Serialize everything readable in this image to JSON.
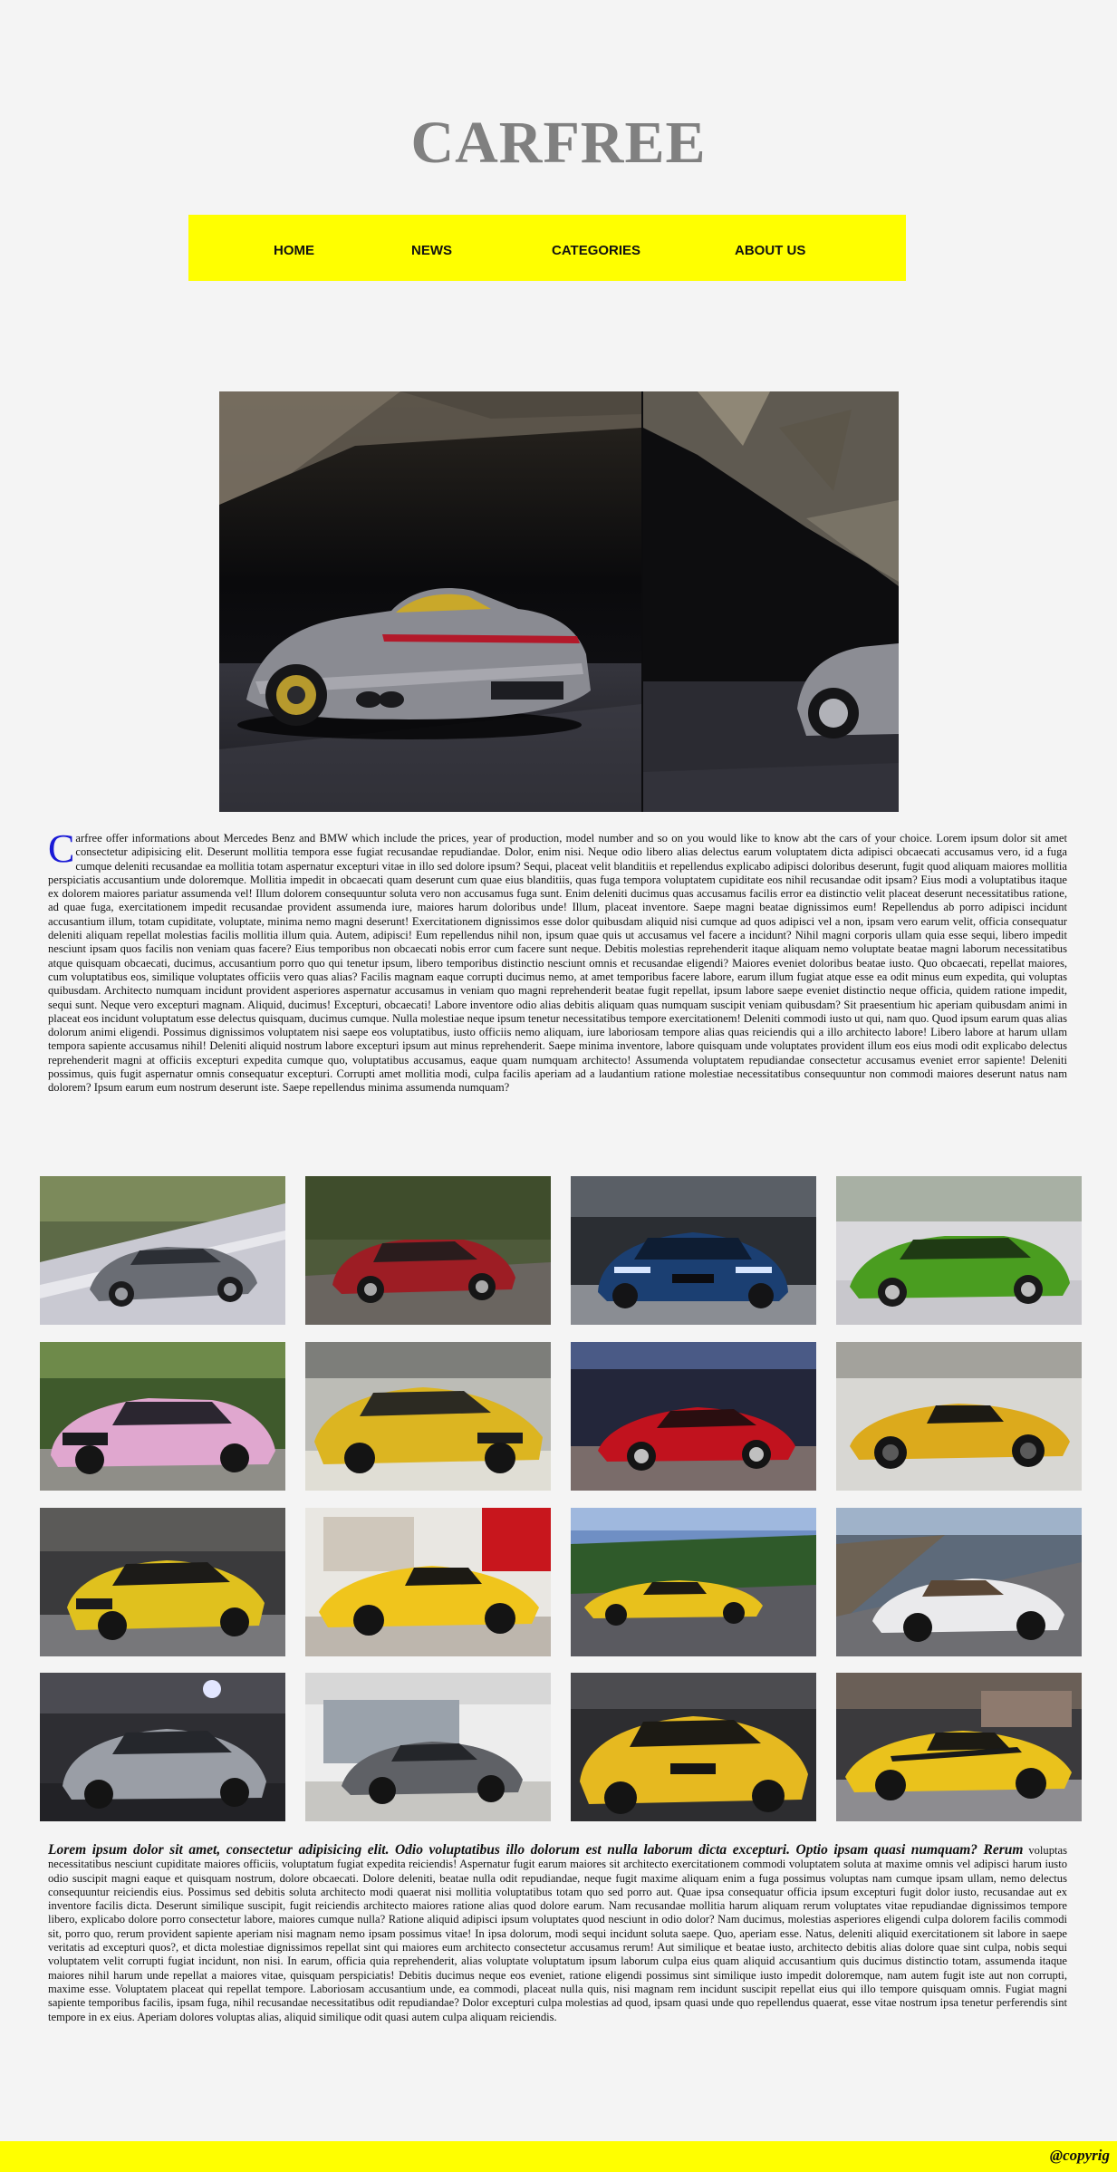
{
  "site": {
    "title": "CARFREE"
  },
  "nav": [
    {
      "label": "HOME"
    },
    {
      "label": "NEWS"
    },
    {
      "label": "CATEGORIES"
    },
    {
      "label": "ABOUT US"
    }
  ],
  "intro": {
    "dropcap": "C",
    "text": "arfree offer informations about Mercedes Benz and BMW which include the prices, year of production, model number and so on you would like to know abt the cars of your choice. Lorem ipsum dolor sit amet consectetur adipisicing elit. Deserunt mollitia tempora esse fugiat recusandae repudiandae. Dolor, enim nisi. Neque odio libero alias delectus earum voluptatem dicta adipisci obcaecati accusamus vero, id a fuga cumque deleniti recusandae ea mollitia totam aspernatur excepturi vitae in illo sed dolore ipsum? Sequi, placeat velit blanditiis et repellendus explicabo adipisci doloribus deserunt, fugit quod aliquam maiores mollitia perspiciatis accusantium unde doloremque. Mollitia impedit in obcaecati quam deserunt cum quae eius blanditiis, quas fuga tempora voluptatem cupiditate eos nihil recusandae odit ipsam? Eius modi a voluptatibus itaque ex dolorem maiores pariatur assumenda vel! Illum dolorem consequuntur soluta vero non accusamus fuga sunt. Enim deleniti ducimus quas accusamus facilis error ea distinctio velit placeat deserunt necessitatibus ratione, ad quae fuga, exercitationem impedit recusandae provident assumenda iure, maiores harum doloribus unde! Illum, placeat inventore. Saepe magni beatae dignissimos eum! Repellendus ab porro adipisci incidunt accusantium illum, totam cupiditate, voluptate, minima nemo magni deserunt! Exercitationem dignissimos esse dolor quibusdam aliquid nisi cumque ad quos adipisci vel a non, ipsam vero earum velit, officia consequatur deleniti aliquam repellat molestias facilis mollitia illum quia. Autem, adipisci! Eum repellendus nihil non, ipsum quae quis ut accusamus vel facere a incidunt? Nihil magni corporis ullam quia esse sequi, libero impedit nesciunt ipsam quos facilis non veniam quas facere? Eius temporibus non obcaecati nobis error cum facere sunt neque. Debitis molestias reprehenderit itaque aliquam nemo voluptate beatae magni laborum necessitatibus atque quisquam obcaecati, ducimus, accusantium porro quo qui tenetur ipsum, libero temporibus distinctio nesciunt omnis et recusandae eligendi? Maiores eveniet doloribus beatae iusto. Quo obcaecati, repellat maiores, cum voluptatibus eos, similique voluptates officiis vero quas alias? Facilis magnam eaque corrupti ducimus nemo, at amet temporibus facere labore, earum illum fugiat atque esse ea odit minus eum expedita, qui voluptas quibusdam. Architecto numquam incidunt provident asperiores aspernatur accusamus in veniam quo magni reprehenderit beatae fugit repellat, ipsum labore saepe eveniet distinctio neque officia, quidem ratione impedit, sequi sunt. Neque vero excepturi magnam. Aliquid, ducimus! Excepturi, obcaecati! Labore inventore odio alias debitis aliquam quas numquam suscipit veniam quibusdam? Sit praesentium hic aperiam quibusdam animi in placeat eos incidunt voluptatum esse delectus quisquam, ducimus cumque. Nulla molestiae neque ipsum tenetur necessitatibus tempore exercitationem! Deleniti commodi iusto ut qui, nam quo. Quod ipsum earum quas alias dolorum animi eligendi. Possimus dignissimos voluptatem nisi saepe eos voluptatibus, iusto officiis nemo aliquam, iure laboriosam tempore alias quas reiciendis qui a illo architecto labore! Libero labore at harum ullam tempora sapiente accusamus nihil! Deleniti aliquid nostrum labore excepturi ipsum aut minus reprehenderit. Saepe minima inventore, labore quisquam unde voluptates provident illum eos eius modi odit explicabo delectus reprehenderit magni at officiis excepturi expedita cumque quo, voluptatibus accusamus, eaque quam numquam architecto! Assumenda voluptatem repudiandae consectetur accusamus eveniet error sapiente! Deleniti possimus, quis fugit aspernatur omnis consequatur excepturi. Corrupti amet mollitia modi, culpa facilis aperiam ad a laudantium ratione molestiae necessitatibus consequuntur non commodi maiores deserunt natus nam dolorem? Ipsum earum eum nostrum deserunt iste. Saepe repellendus minima assumenda numquam?"
  },
  "gallery": [
    {
      "name": "gray-mercedes-coupe"
    },
    {
      "name": "red-tesla-sedan"
    },
    {
      "name": "blue-bmw-coupe"
    },
    {
      "name": "green-bmw-sedan"
    },
    {
      "name": "pink-bmw-sedan"
    },
    {
      "name": "yellow-bmw-sedan"
    },
    {
      "name": "red-ferrari-coupe"
    },
    {
      "name": "yellow-ferrari-spider"
    },
    {
      "name": "yellow-bmw-m3"
    },
    {
      "name": "yellow-ferrari-enzo"
    },
    {
      "name": "yellow-ferrari-road"
    },
    {
      "name": "white-mercedes-cabrio"
    },
    {
      "name": "silver-mercedes-eclass"
    },
    {
      "name": "gray-tesla-garage"
    },
    {
      "name": "yellow-bmw-m4"
    },
    {
      "name": "yellow-ferrari-458"
    }
  ],
  "outro": {
    "lead": "Lorem ipsum dolor sit amet, consectetur adipisicing elit. Odio voluptatibus illo dolorum est nulla laborum dicta excepturi. Optio ipsam quasi numquam? Rerum",
    "text": "voluptas necessitatibus nesciunt cupiditate maiores officiis, voluptatum fugiat expedita reiciendis! Aspernatur fugit earum maiores sit architecto exercitationem commodi voluptatem soluta at maxime omnis vel adipisci harum iusto odio suscipit magni eaque et quisquam nostrum, dolore obcaecati. Dolore deleniti, beatae nulla odit repudiandae, neque fugit maxime aliquam enim a fuga possimus voluptas nam cumque ipsam ullam, nemo delectus consequuntur reiciendis eius. Possimus sed debitis soluta architecto modi quaerat nisi mollitia voluptatibus totam quo sed porro aut. Quae ipsa consequatur officia ipsum excepturi fugit dolor iusto, recusandae aut ex inventore facilis dicta. Deserunt similique suscipit, fugit reiciendis architecto maiores ratione alias quod dolore earum. Nam recusandae mollitia harum aliquam rerum voluptates vitae repudiandae dignissimos tempore libero, explicabo dolore porro consectetur labore, maiores cumque nulla? Ratione aliquid adipisci ipsum voluptates quod nesciunt in odio dolor? Nam ducimus, molestias asperiores eligendi culpa dolorem facilis commodi sit, porro quo, rerum provident sapiente aperiam nisi magnam nemo ipsam possimus vitae! In ipsa dolorum, modi sequi incidunt soluta saepe. Quo, aperiam esse. Natus, deleniti aliquid exercitationem sit labore in saepe veritatis ad excepturi quos?, et dicta molestiae dignissimos repellat sint qui maiores eum architecto consectetur accusamus rerum! Aut similique et beatae iusto, architecto debitis alias dolore quae sint culpa, nobis sequi voluptatem velit corrupti fugiat incidunt, non nisi. In earum, officia quia reprehenderit, alias voluptate voluptatum ipsum laborum culpa eius quam aliquid accusantium quis ducimus distinctio totam, assumenda itaque maiores nihil harum unde repellat a maiores vitae, quisquam perspiciatis! Debitis ducimus neque eos eveniet, ratione eligendi possimus sint similique iusto impedit doloremque, nam autem fugit iste aut non corrupti, maxime esse. Voluptatem placeat qui repellat tempore. Laboriosam accusantium unde, ea commodi, placeat nulla quis, nisi magnam rem incidunt suscipit repellat eius qui illo tempore quisquam omnis. Fugiat magni sapiente temporibus facilis, ipsam fuga, nihil recusandae necessitatibus odit repudiandae? Dolor excepturi culpa molestias ad quod, ipsam quasi unde quo repellendus quaerat, esse vitae nostrum ipsa tenetur perferendis sint tempore in ex eius. Aperiam dolores voluptas alias, aliquid similique odit quasi autem culpa aliquam reiciendis."
  },
  "footer": {
    "copyright": "@copyrig"
  },
  "colors": {
    "nav_bg": "#ffff00",
    "footer_bg": "#ffff00",
    "title": "#808080",
    "dropcap": "#1a1ad6",
    "page_bg": "#f4f4f4"
  }
}
